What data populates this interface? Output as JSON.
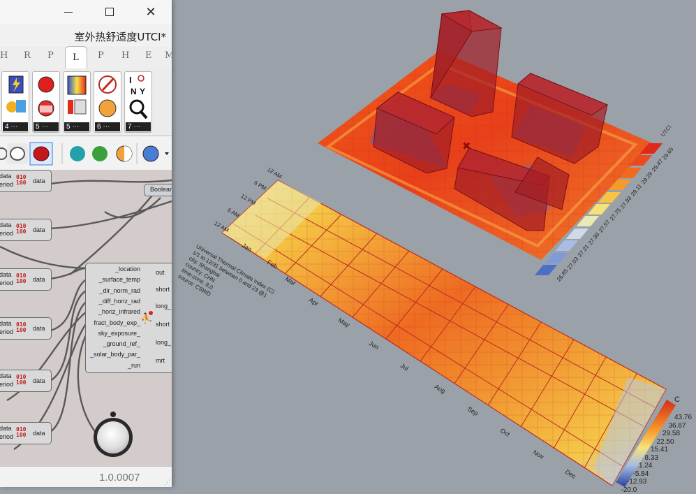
{
  "window": {
    "title": "室外热舒适度UTCI*",
    "version": "1.0.0007",
    "controls": {
      "minimize": "minimize",
      "maximize": "maximize",
      "close": "close"
    }
  },
  "tabs": [
    {
      "label": "H",
      "active": false
    },
    {
      "label": "R",
      "active": false
    },
    {
      "label": "P",
      "active": false
    },
    {
      "label": "L",
      "active": true
    },
    {
      "label": "P",
      "active": false
    },
    {
      "label": "H",
      "active": false
    },
    {
      "label": "E",
      "active": false
    },
    {
      "label": "M",
      "active": false
    }
  ],
  "ribbon": {
    "groups": [
      {
        "count": "4"
      },
      {
        "count": "5"
      },
      {
        "count": "5"
      },
      {
        "count": "6"
      },
      {
        "count": "7"
      }
    ],
    "search_letters": [
      "I",
      "N",
      "Y"
    ]
  },
  "canvas": {
    "data_nodes": [
      {
        "label1": "data",
        "label2": "eriod",
        "out": "data"
      },
      {
        "label1": "data",
        "label2": "eriod",
        "out": "data"
      },
      {
        "label1": "data",
        "label2": "eriod",
        "out": "data"
      },
      {
        "label1": "data",
        "label2": "eriod",
        "out": "data"
      },
      {
        "label1": "data",
        "label2": "eriod",
        "out": "data"
      },
      {
        "label1": "data",
        "label2": "eriod",
        "out": "data"
      }
    ],
    "bits_icon": "010\n100",
    "boolean_node": "Boolean",
    "utci_inputs": [
      "_location",
      "_surface_temp",
      "_dir_norm_rad",
      "_diff_horiz_rad",
      "_horiz_infrared",
      "fract_body_exp_",
      "sky_exposure_",
      "_ground_ref_",
      "_solar_body_par_",
      "_run"
    ],
    "utci_outputs": [
      "out",
      "short",
      "long_",
      "short",
      "long_",
      "mrt"
    ]
  },
  "viewport": {
    "site_legend": {
      "title": "UTCI",
      "values": [
        "29.65",
        "29.47",
        "29.29",
        "29.11",
        "27.93",
        "27.75",
        "27.57",
        "27.39",
        "27.21",
        "27.03",
        "26.85"
      ]
    },
    "chart_legend": {
      "unit": "C",
      "values": [
        "43.76",
        "36.67",
        "29.58",
        "22.50",
        "15.41",
        "8.33",
        "1.24",
        "-5.84",
        "-12.93",
        "-20.0"
      ]
    },
    "chart_caption": [
      "Universal Thermal Climate Index (C)",
      "1/1 to 12/31 between 0 and 23 @1",
      "city: Shanghai",
      "country: CHN",
      "time-zone: 8.0",
      "source: CSWD"
    ],
    "hour_labels": [
      "12 AM",
      "6 PM",
      "12 PM",
      "6 AM",
      "12 AM"
    ],
    "month_labels": [
      "Jan",
      "Feb",
      "Mar",
      "Apr",
      "May",
      "Jun",
      "Jul",
      "Aug",
      "Sep",
      "Oct",
      "Nov",
      "Dec"
    ],
    "colors": {
      "hot": "#d42c18",
      "warm": "#f26a1e",
      "mild": "#f7d34a",
      "cool": "#8fa8d8",
      "cold": "#2d55b8",
      "building_fill": "#a31d23"
    }
  }
}
